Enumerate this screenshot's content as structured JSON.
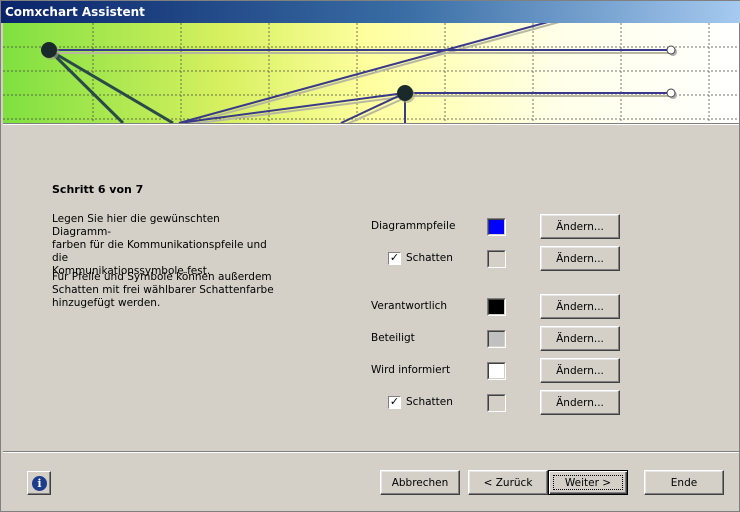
{
  "window": {
    "title": "Comxchart Assistent"
  },
  "step": {
    "title": "Schritt 6 von 7"
  },
  "description": {
    "paragraph1": [
      "Legen Sie hier die gewünschten Diagramm-",
      "farben für die Kommunikationspfeile und die",
      "Kommunikationssymbole fest."
    ],
    "paragraph2": [
      "Für Pfeile und Symbole können außerdem",
      "Schatten mit frei wählbarer Schattenfarbe",
      "hinzugefügt werden."
    ]
  },
  "colors": {
    "diagrammpfeile": {
      "label": "Diagrammpfeile",
      "color": "#0000ff",
      "button": "Ändern..."
    },
    "schatten1": {
      "label": "Schatten",
      "checked": true,
      "color": "#d4d0c8",
      "button": "Ändern..."
    },
    "verantwortlich": {
      "label": "Verantwortlich",
      "color": "#000000",
      "button": "Ändern..."
    },
    "beteiligt": {
      "label": "Beteiligt",
      "color": "#c0c0c0",
      "button": "Ändern..."
    },
    "wird_informiert": {
      "label": "Wird informiert",
      "color": "#ffffff",
      "button": "Ändern..."
    },
    "schatten2": {
      "label": "Schatten",
      "checked": true,
      "color": "#d4d0c8",
      "button": "Ändern..."
    }
  },
  "footer": {
    "info_icon": "info-icon",
    "cancel": "Abbrechen",
    "back": "< Zurück",
    "next": "Weiter >",
    "finish": "Ende"
  }
}
